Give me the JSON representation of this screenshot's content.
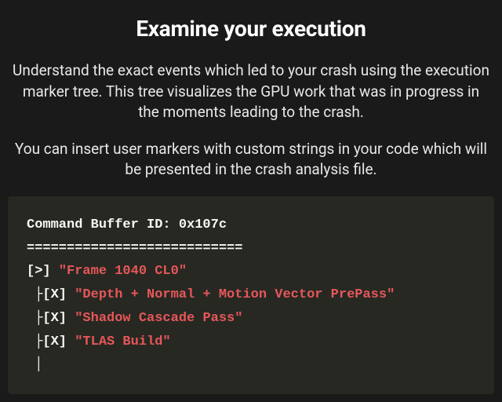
{
  "heading": "Examine your execution",
  "paragraph1": "Understand the exact events which led to your crash using the execution marker tree. This tree visualizes the GPU work that was in progress in the moments leading to the crash.",
  "paragraph2": "You can insert user markers with custom strings in your code which will be presented in the crash analysis file.",
  "code": {
    "header": "Command Buffer ID: 0x107c",
    "divider": "===========================",
    "lines": [
      {
        "marker": "[>] ",
        "string": "\"Frame 1040 CL0\""
      },
      {
        "marker": " ├[X] ",
        "string": "\"Depth + Normal + Motion Vector PrePass\""
      },
      {
        "marker": " ├[X] ",
        "string": "\"Shadow Cascade Pass\""
      },
      {
        "marker": " ├[X] ",
        "string": "\"TLAS Build\""
      },
      {
        "marker": " │",
        "string": ""
      }
    ]
  }
}
